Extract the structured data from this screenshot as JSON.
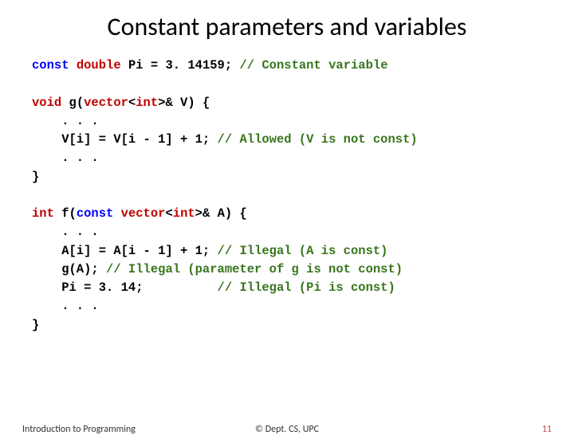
{
  "title": "Constant parameters and variables",
  "code": {
    "l1a": "const",
    "l1b": " ",
    "l1c": "double",
    "l1d": " Pi = 3. 14159; ",
    "l1e": "// Constant variable",
    "l2a": "void",
    "l2b": " g(",
    "l2c": "vector",
    "l2d": "<",
    "l2e": "int",
    "l2f": ">& V) {",
    "l3": "    . . .",
    "l4a": "    V[i] = V[i - 1] + 1; ",
    "l4b": "// Allowed (V is not const)",
    "l5": "    . . .",
    "l6": "}",
    "l7a": "int",
    "l7b": " f(",
    "l7c": "const",
    "l7d": " ",
    "l7e": "vector",
    "l7f": "<",
    "l7g": "int",
    "l7h": ">& A) {",
    "l8": "    . . .",
    "l9a": "    A[i] = A[i - 1] + 1; ",
    "l9b": "// Illegal (A is const)",
    "l10a": "    g(A); ",
    "l10b": "// Illegal (parameter of g is not const)",
    "l11a": "    Pi = 3. 14;          ",
    "l11b": "// Illegal (Pi is const)",
    "l12": "    . . .",
    "l13": "}"
  },
  "footer": {
    "left": "Introduction to Programming",
    "center": "© Dept. CS, UPC",
    "right": "11"
  }
}
